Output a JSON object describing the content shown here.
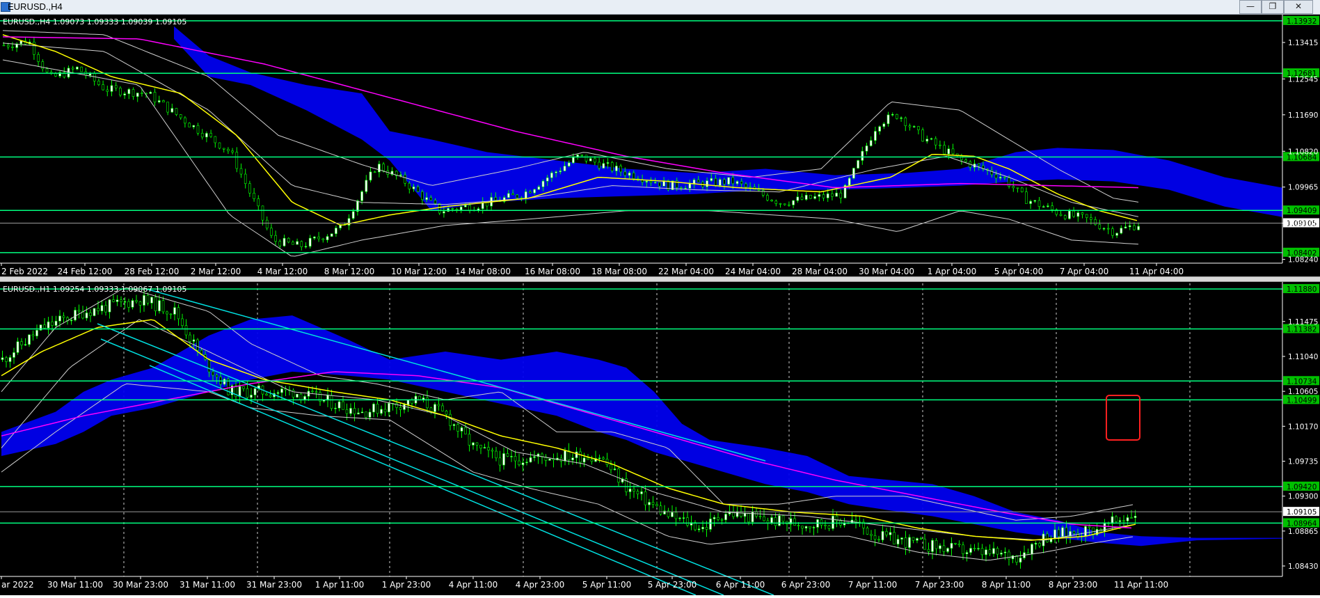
{
  "window": {
    "title": "EURUSD.,H4",
    "minimize_label": "—",
    "restore_label": "❐",
    "close_label": "✕"
  },
  "charts": [
    {
      "id": "h4",
      "header": "EURUSD.,H4  1.09073 1.09333 1.09039 1.09105",
      "time_labels": [
        "2 Feb 2022",
        "24 Feb 12:00",
        "28 Feb 12:00",
        "2 Mar 12:00",
        "4 Mar 12:00",
        "8 Mar 12:00",
        "10 Mar 12:00",
        "14 Mar 08:00",
        "16 Mar 08:00",
        "18 Mar 08:00",
        "22 Mar 04:00",
        "24 Mar 04:00",
        "28 Mar 04:00",
        "30 Mar 04:00",
        "1 Apr 04:00",
        "5 Apr 04:00",
        "7 Apr 04:00",
        "11 Apr 04:00"
      ],
      "price_scale": [
        "1.13415",
        "1.12545",
        "1.11690",
        "1.10820",
        "1.09965",
        "1.09105",
        "1.08240"
      ],
      "level_labels": [
        "1.13932",
        "1.12681",
        "1.10684",
        "1.09409",
        "1.08402"
      ],
      "current_price": "1.09105",
      "price_min": 1.0815,
      "price_max": 1.1398
    },
    {
      "id": "h1",
      "header": "EURUSD.,H1  1.09254 1.09333 1.09067 1.09105",
      "time_labels": [
        "ar 2022",
        "30 Mar 11:00",
        "30 Mar 23:00",
        "31 Mar 11:00",
        "31 Mar 23:00",
        "1 Apr 11:00",
        "1 Apr 23:00",
        "4 Apr 11:00",
        "4 Apr 23:00",
        "5 Apr 11:00",
        "5 Apr 23:00",
        "6 Apr 11:00",
        "6 Apr 23:00",
        "7 Apr 11:00",
        "7 Apr 23:00",
        "8 Apr 11:00",
        "8 Apr 23:00",
        "11 Apr 11:00"
      ],
      "price_scale": [
        "1.11475",
        "1.11040",
        "1.10605",
        "1.10170",
        "1.09735",
        "1.09300",
        "1.08865",
        "1.08430"
      ],
      "level_labels": [
        "1.11880",
        "1.11382",
        "1.10734",
        "1.10499",
        "1.09420",
        "1.08964"
      ],
      "current_price": "1.09105",
      "price_min": 1.083,
      "price_max": 1.1195
    }
  ],
  "colors": {
    "background": "#000000",
    "bull_candle": "#ffffff",
    "bear_candle": "#000000",
    "wick": "#00ff00",
    "level_line": "#00ff7f",
    "level_label_bg": "#00c000",
    "ema_fast": "#ffff00",
    "ema_slow": "#ff00ff",
    "ichimoku_cloud": "#0000ee",
    "bollinger": "#cfcfcf",
    "channel": "#00e0e0",
    "highlight_box": "#ff2020",
    "grid": "#ffffff"
  }
}
